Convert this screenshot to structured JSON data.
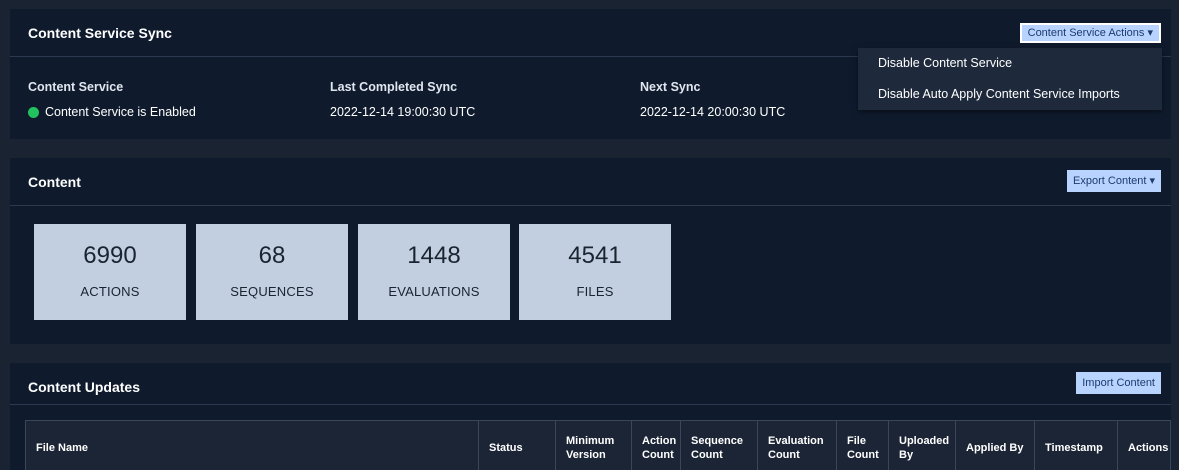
{
  "sync_panel": {
    "title": "Content Service Sync",
    "actions_button": "Content Service Actions ▾",
    "dropdown": [
      "Disable Content Service",
      "Disable Auto Apply Content Service Imports"
    ],
    "content_service_label": "Content Service",
    "content_service_status": "Content Service is Enabled",
    "status_color": "#22c35e",
    "last_sync_label": "Last Completed Sync",
    "last_sync_value": "2022-12-14 19:00:30 UTC",
    "next_sync_label": "Next Sync",
    "next_sync_value": "2022-12-14 20:00:30 UTC"
  },
  "content_panel": {
    "title": "Content",
    "export_button": "Export Content ▾",
    "stats": [
      {
        "value": "6990",
        "label": "ACTIONS"
      },
      {
        "value": "68",
        "label": "SEQUENCES"
      },
      {
        "value": "1448",
        "label": "EVALUATIONS"
      },
      {
        "value": "4541",
        "label": "FILES"
      }
    ]
  },
  "updates_panel": {
    "title": "Content Updates",
    "import_button": "Import Content",
    "columns": [
      "File Name",
      "Status",
      "Minimum Version",
      "Action Count",
      "Sequence Count",
      "Evaluation Count",
      "File Count",
      "Uploaded By",
      "Applied By",
      "Timestamp",
      "Actions"
    ]
  }
}
